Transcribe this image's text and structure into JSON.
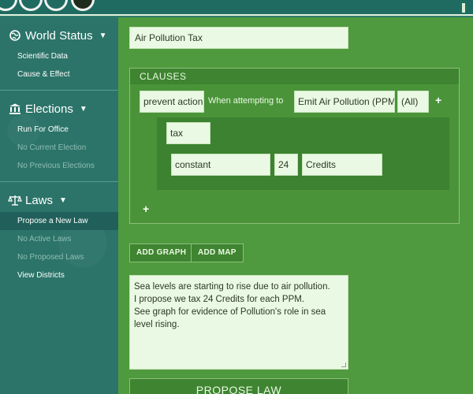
{
  "sidebar": {
    "world_status": {
      "title": "World Status",
      "items": [
        "Scientific Data",
        "Cause & Effect"
      ]
    },
    "elections": {
      "title": "Elections",
      "items": [
        "Run For Office",
        "No Current Election",
        "No Previous Elections"
      ]
    },
    "laws": {
      "title": "Laws",
      "items": [
        "Propose a New Law",
        "No Active Laws",
        "No Proposed Laws",
        "View Districts"
      ]
    }
  },
  "law": {
    "title": "Air Pollution Tax",
    "clauses_header": "CLAUSES",
    "clause": {
      "action": "prevent action",
      "when_label": "When attempting to",
      "target": "Emit Air Pollution (PPM)",
      "scope": "(All)",
      "effect": "tax",
      "mode": "constant",
      "amount": "24",
      "currency": "Credits"
    },
    "add_graph": "ADD GRAPH",
    "add_map": "ADD MAP",
    "description_lines": [
      "Sea levels are starting to rise due to air pollution.",
      "I propose we tax 24 Credits for each PPM.",
      "See graph for evidence of Pollution's role in sea level rising."
    ],
    "propose_button": "PROPOSE LAW"
  },
  "icons": {
    "world": "globe-icon",
    "elections": "government-building-icon",
    "laws": "scales-icon",
    "caret": "caret-down-icon",
    "add": "plus-icon"
  },
  "colors": {
    "main_bg": "#4f9a3e",
    "sidebar_bg": "#2c7469",
    "input_bg": "#eaf9e4",
    "button_bg": "#3f8431"
  }
}
